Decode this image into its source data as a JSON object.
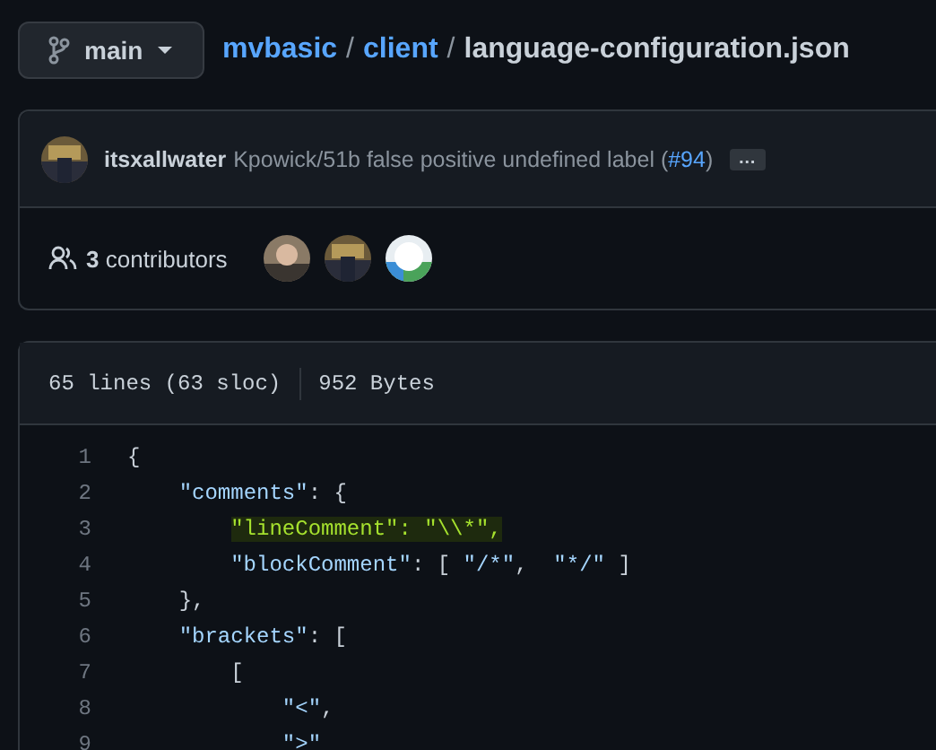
{
  "branch": {
    "label": "main"
  },
  "breadcrumb": [
    {
      "text": "mvbasic",
      "kind": "link"
    },
    {
      "text": "/",
      "kind": "sep"
    },
    {
      "text": "client",
      "kind": "link"
    },
    {
      "text": "/",
      "kind": "sep"
    },
    {
      "text": "language-configuration.json",
      "kind": "file"
    }
  ],
  "commit": {
    "author": "itsxallwater",
    "message": "Kpowick/51b false positive undefined label (",
    "pr": "#94",
    "close": ")",
    "more": "…"
  },
  "contributors": {
    "count": "3",
    "label": "contributors"
  },
  "file_info": {
    "lines": "65 lines (63 sloc)",
    "size": "952 Bytes"
  },
  "code": [
    {
      "number": "1",
      "highlighted": false,
      "tokens": [
        {
          "kind": "punct",
          "text": "{"
        }
      ]
    },
    {
      "number": "2",
      "highlighted": false,
      "tokens": [
        {
          "kind": "string",
          "text": "    \"comments\""
        },
        {
          "kind": "punct",
          "text": ": {"
        }
      ]
    },
    {
      "number": "3",
      "highlighted": true,
      "tokens": [
        {
          "kind": "string",
          "text": "        \"lineComment\""
        },
        {
          "kind": "punct",
          "text": ": "
        },
        {
          "kind": "string",
          "text": "\"\\\\*\""
        },
        {
          "kind": "punct",
          "text": ","
        }
      ]
    },
    {
      "number": "4",
      "highlighted": false,
      "tokens": [
        {
          "kind": "string",
          "text": "        \"blockComment\""
        },
        {
          "kind": "punct",
          "text": ": [ "
        },
        {
          "kind": "string",
          "text": "\"/*\""
        },
        {
          "kind": "punct",
          "text": ",  "
        },
        {
          "kind": "string",
          "text": "\"*/\""
        },
        {
          "kind": "punct",
          "text": " ]"
        }
      ]
    },
    {
      "number": "5",
      "highlighted": false,
      "tokens": [
        {
          "kind": "punct",
          "text": "    },"
        }
      ]
    },
    {
      "number": "6",
      "highlighted": false,
      "tokens": [
        {
          "kind": "string",
          "text": "    \"brackets\""
        },
        {
          "kind": "punct",
          "text": ": ["
        }
      ]
    },
    {
      "number": "7",
      "highlighted": false,
      "tokens": [
        {
          "kind": "punct",
          "text": "        ["
        }
      ]
    },
    {
      "number": "8",
      "highlighted": false,
      "tokens": [
        {
          "kind": "string",
          "text": "            \"<\""
        },
        {
          "kind": "punct",
          "text": ","
        }
      ]
    },
    {
      "number": "9",
      "highlighted": false,
      "tokens": [
        {
          "kind": "string",
          "text": "            \">\""
        }
      ]
    }
  ]
}
